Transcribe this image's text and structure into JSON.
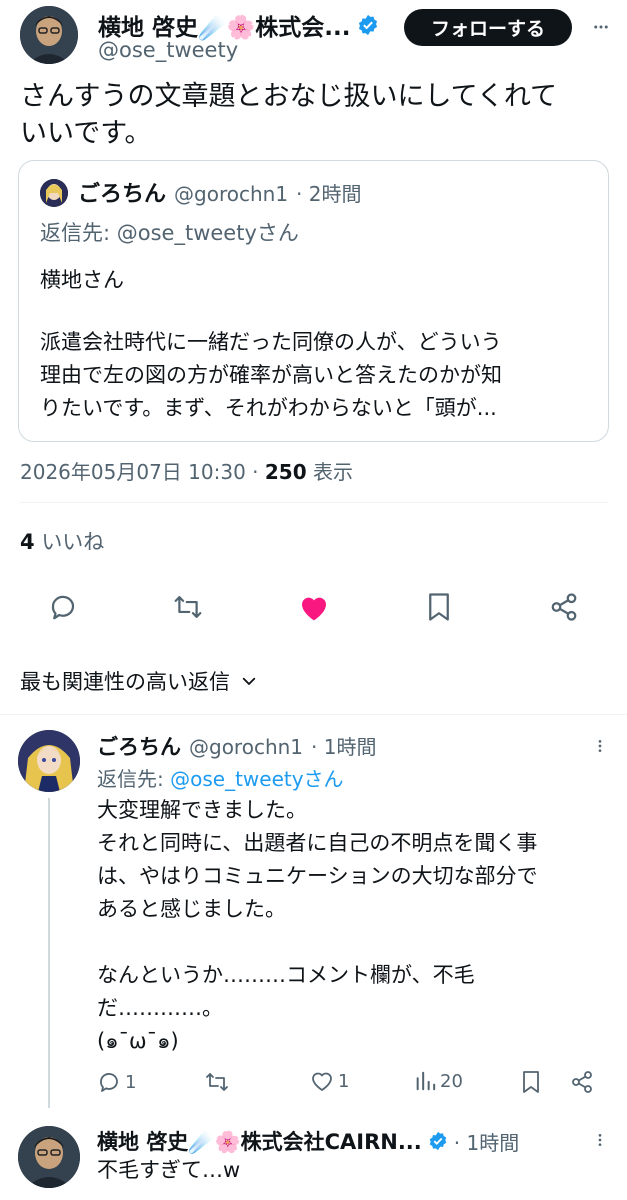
{
  "main_tweet": {
    "author_name": "横地 啓史☄️🌸株式会...",
    "author_handle": "@ose_tweety",
    "follow_label": "フォローする",
    "text_lines": [
      "さんすうの文章題とおなじ扱いにしてくれて",
      "いいです。"
    ],
    "timestamp": "2026年05月07日 10:30",
    "separator": "·",
    "views_count": "250",
    "views_label": "表示",
    "likes_count": "4",
    "likes_label": "いいね"
  },
  "quoted_tweet": {
    "author_name": "ごろちん",
    "author_handle": "@gorochn1",
    "time": "· 2時間",
    "reply_to": "返信先: @ose_tweetyさん",
    "greeting": "横地さん",
    "body_lines": [
      "派遣会社時代に一緒だった同僚の人が、どういう",
      "理由で左の図の方が確率が高いと答えたのかが知",
      "りたいです。まず、それがわからないと「頭が..."
    ]
  },
  "sort_label": "最も関連性の高い返信",
  "replies": [
    {
      "author_name": "ごろちん",
      "author_handle": "@gorochn1",
      "time": "· 1時間",
      "reply_to_prefix": "返信先: ",
      "reply_to_handle": "@ose_tweetyさん",
      "body_lines": [
        "大変理解できました。",
        "それと同時に、出題者に自己の不明点を聞く事",
        "は、やはりコミュニケーションの大切な部分で",
        "あると感じました。",
        "",
        "なんというか………コメント欄が、不毛",
        "だ…………。",
        "(๑¯ω¯๑)"
      ],
      "reply_count": "1",
      "like_count": "1",
      "view_count": "20"
    },
    {
      "author_name": "横地 啓史☄️🌸株式会社CAIRN...",
      "time": "· 1時間",
      "text": "不毛すぎて…w"
    }
  ],
  "colors": {
    "like_active": "#f91880",
    "link": "#1d9bf0",
    "verified": "#1d9bf0",
    "secondary_text": "#536471"
  }
}
